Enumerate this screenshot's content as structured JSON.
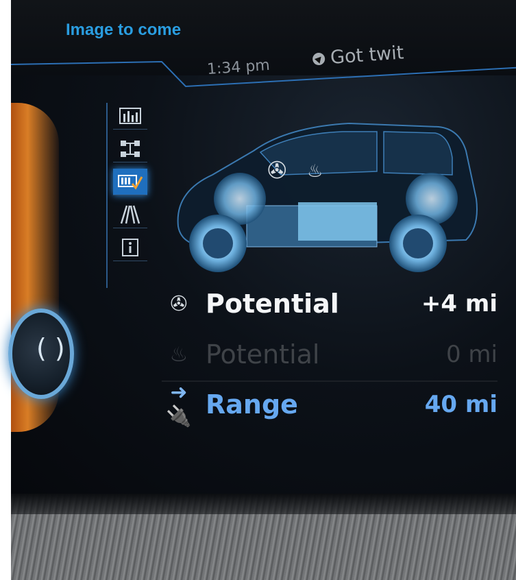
{
  "header": {
    "title": "Image to come",
    "time": "1:34 pm",
    "media_text": "Got twit"
  },
  "menu": {
    "items": [
      {
        "name": "chart-icon",
        "glyph": "📊"
      },
      {
        "name": "drivetrain-icon",
        "glyph": "⚙"
      },
      {
        "name": "battery-check-icon",
        "glyph": "🔋"
      },
      {
        "name": "road-icon",
        "glyph": "//\\"
      },
      {
        "name": "info-icon",
        "glyph": "ℹ"
      }
    ]
  },
  "stats": {
    "rows": [
      {
        "icon": "fan-icon",
        "icon_glyph": "✇",
        "label": "Potential",
        "value": "+4 mi"
      },
      {
        "icon": "seat-heat-icon",
        "icon_glyph": "♨",
        "label": "Potential",
        "value": "0 mi"
      },
      {
        "icon": "plug-icon",
        "icon_glyph": "➜🔌",
        "label": "Range",
        "value": "40 mi"
      }
    ]
  },
  "colors": {
    "title_blue": "#2a9de0",
    "range_blue": "#66a8f0",
    "active_menu": "#1f6fbe",
    "dial_orange": "#f08a28"
  }
}
